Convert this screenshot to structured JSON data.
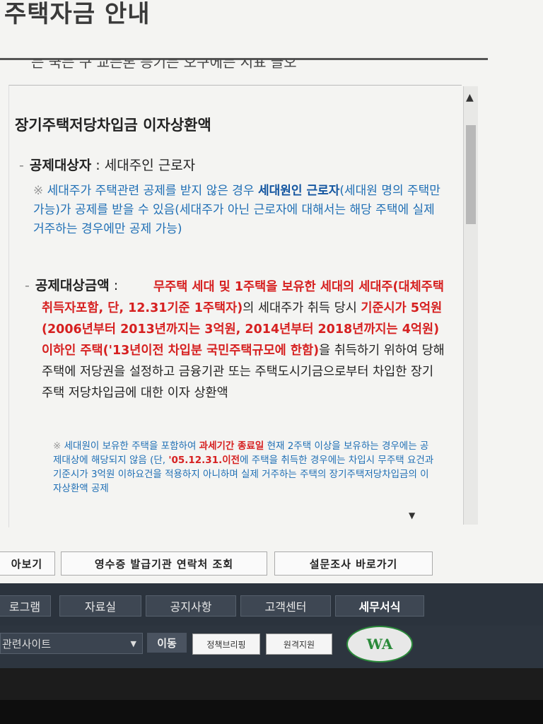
{
  "page_title": "주택자금 안내",
  "cut_text": "는 국는 구 교는론 등기는 오구에는 시표 글오",
  "section": {
    "heading": "장기주택저당차입금 이자상환액",
    "target_label": "공제대상자",
    "target_value": "세대주인 근로자",
    "note1_mark": "※",
    "note1_a": "세대주가 주택관련 공제를 받지 않은 경우 ",
    "note1_b": "세대원인 근로자",
    "note1_c": "(세대원 명의 주택만 가능)가 공제를 받을 수 있음(세대주가 아닌 근로자에 대해서는 해당 주택에 실제 거주하는 경우에만 공제 가능)",
    "amount_label": "공제대상금액",
    "amount_red1": "무주택 세대 및 1주택을 보유한 세대의 세대주(대체주택 취득자포함, 단, 12.31기준 1주택자)",
    "amount_text1": "의 세대주가 취득 당시 ",
    "amount_red2": "기준시가 5억원(2006년부터 2013년까지는 3억원, 2014년부터 2018년까지는 4억원) 이하인 주택('13년이전 차입분 국민주택규모에 한함)",
    "amount_text2": "을 취득하기 위하여 당해 주택에 저당권을 설정하고 금융기관 또는 주택도시기금으로부터 차입한 장기주택 저당차입금에 대한 이자 상환액",
    "note2_mark": "※",
    "note2_a": "세대원이 보유한 주택을 포함하여 ",
    "note2_red": "과세기간 종료일",
    "note2_b": " 현재 2주택 이상을 보유하는 경우에는 공제대상에 해당되지 않음 (단, ",
    "note2_red2": "'05.12.31.이전",
    "note2_c": "에 주택을 취득한 경우에는 차입시 무주택 요건과 기준시가 3억원 이하요건을 적용하지 아니하며 실제 거주하는 주택의 장기주택저당차입금의 이자상환액 공제"
  },
  "buttons": {
    "lookup": "아보기",
    "receipt": "영수증 발급기관 연락처 조회",
    "survey": "설문조사 바로가기"
  },
  "nav": [
    "로그램",
    "자료실",
    "공지사항",
    "고객센터",
    "세무서식"
  ],
  "footer": {
    "related_sites": "관련사이트",
    "go": "이동",
    "banner1": "정책브리핑",
    "banner2": "원격지원",
    "wa_mark": "WA"
  },
  "icons": {
    "scroll_up": "triangle-up-icon",
    "scroll_down": "triangle-down-icon",
    "select_arrow": "caret-down-icon"
  },
  "colors": {
    "red_emphasis": "#d62020",
    "blue_note": "#1f6fb5",
    "nav_bg": "#2b333d"
  }
}
